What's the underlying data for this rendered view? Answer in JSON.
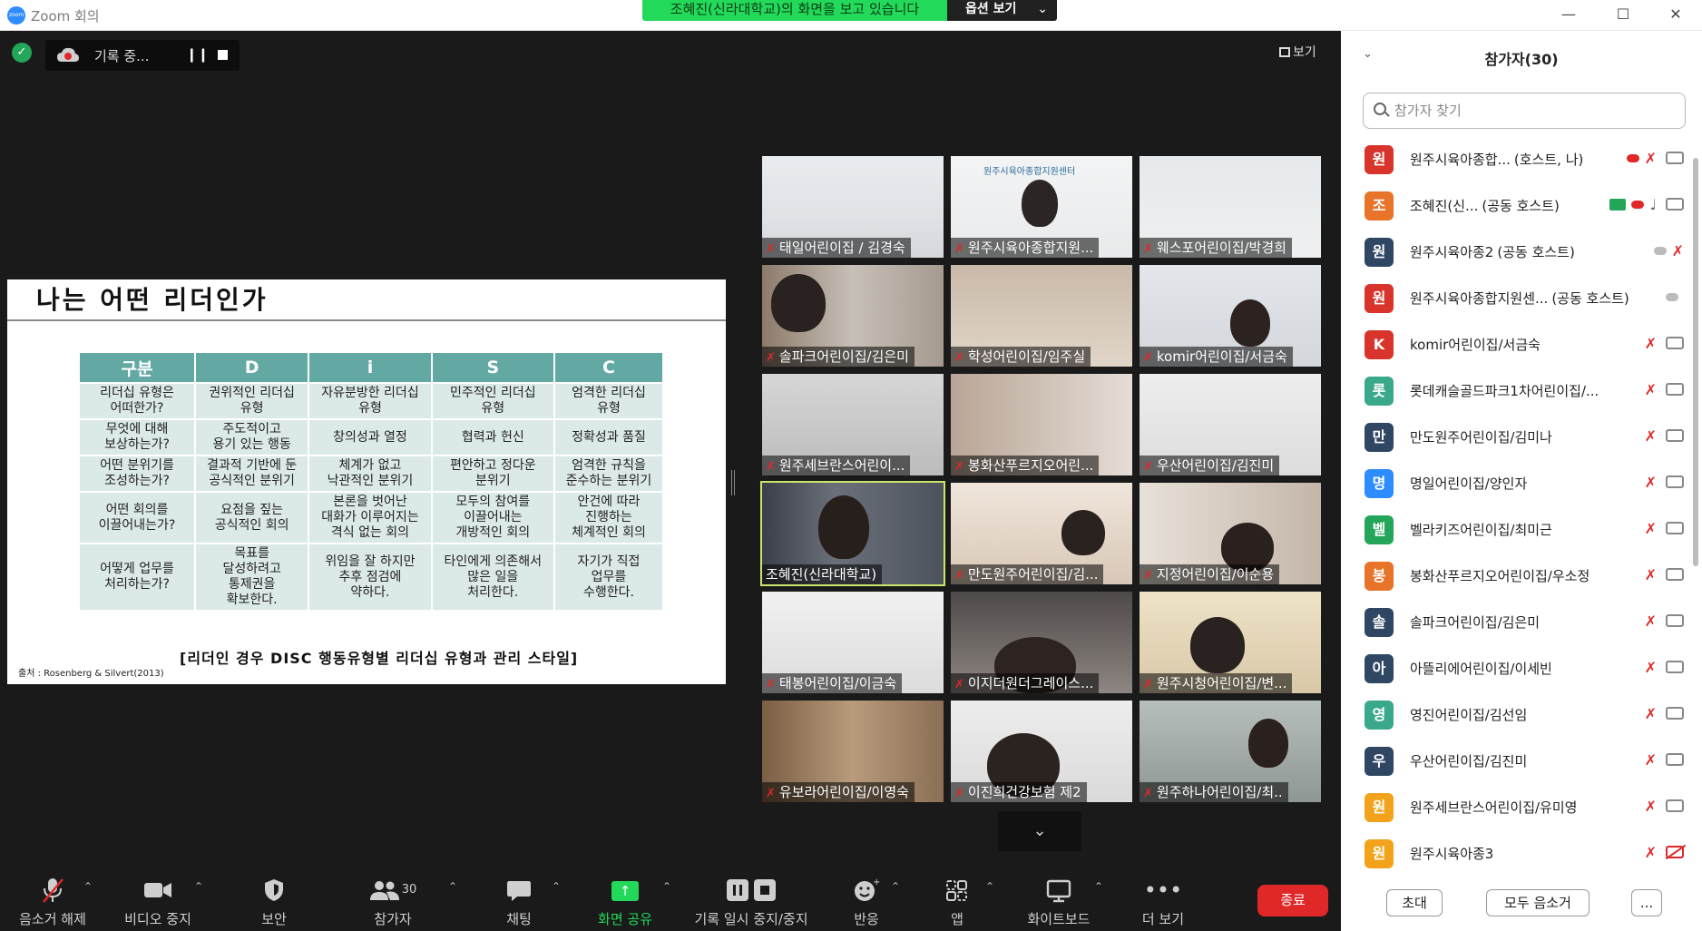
{
  "window": {
    "title": "Zoom 회의",
    "logo_text": "zoom"
  },
  "share_banner": {
    "text": "조혜진(신라대학교)의 화면을 보고 있습니다",
    "options": "옵션 보기"
  },
  "recording": {
    "label": "기록 중..."
  },
  "view_button": {
    "label": "보기"
  },
  "slide": {
    "title": "나는 어떤 리더인가",
    "headers": [
      "구분",
      "D",
      "i",
      "S",
      "C"
    ],
    "rows": [
      [
        "리더십 유형은\n어떠한가?",
        "권위적인 리더십\n유형",
        "자유분방한 리더십\n유형",
        "민주적인 리더십\n유형",
        "엄격한 리더십\n유형"
      ],
      [
        "무엇에 대해\n보상하는가?",
        "주도적이고\n용기 있는 행동",
        "창의성과 열정",
        "협력과 헌신",
        "정확성과 품질"
      ],
      [
        "어떤 분위기를\n조성하는가?",
        "결과적 기반에 둔\n공식적인 분위기",
        "체계가 없고\n낙관적인 분위기",
        "편안하고 정다운\n분위기",
        "엄격한 규칙을\n준수하는 분위기"
      ],
      [
        "어떤 회의를\n이끌어내는가?",
        "요점을 짚는\n공식적인 회의",
        "본론을 벗어난\n대화가 이루어지는\n격식 없는 회의",
        "모두의 참여를\n이끌어내는\n개방적인 회의",
        "안건에 따라\n진행하는\n체계적인 회의"
      ],
      [
        "어떻게 업무를\n처리하는가?",
        "목표를\n달성하려고\n통제권을\n확보한다.",
        "위임을 잘 하지만\n추후 점검에\n약하다.",
        "타인에게 의존해서\n많은 일을\n처리한다.",
        "자기가 직접\n업무를\n수행한다."
      ]
    ],
    "caption": "[리더인 경우 DISC 행동유형별 리더십 유형과 관리 스타일]",
    "source": "출처 : Rosenberg & Silvert(2013)"
  },
  "video_tiles": [
    {
      "label": "태일어린이집 / 김경숙",
      "muted": true
    },
    {
      "label": "원주시육아종합지원...",
      "muted": true
    },
    {
      "label": "웨스포어린이집/박경희",
      "muted": true
    },
    {
      "label": "솔파크어린이집/김은미",
      "muted": true
    },
    {
      "label": "학성어린이집/임주실",
      "muted": true
    },
    {
      "label": "komir어린이집/서금숙",
      "muted": true
    },
    {
      "label": "원주세브란스어린이...",
      "muted": true
    },
    {
      "label": "봉화산푸르지오어린...",
      "muted": true
    },
    {
      "label": "우산어린이집/김진미",
      "muted": true
    },
    {
      "label": "조혜진(신라대학교)",
      "muted": false
    },
    {
      "label": "만도원주어린이집/김...",
      "muted": true
    },
    {
      "label": "지정어린이집/이순용",
      "muted": true
    },
    {
      "label": "태봉어린이집/이금숙",
      "muted": true
    },
    {
      "label": "이지더원더그레이스...",
      "muted": true
    },
    {
      "label": "원주시청어린이집/변...",
      "muted": true
    },
    {
      "label": "유보라어린이집/이영숙",
      "muted": true
    },
    {
      "label": "이진희건강보험 제2",
      "muted": true
    },
    {
      "label": "원주하나어린이집/최..",
      "muted": true
    }
  ],
  "video_logo_text": "원주시육아종합지원센터",
  "toolbar": {
    "unmute": "음소거 해제",
    "stop_video": "비디오 중지",
    "security": "보안",
    "participants": "참가자",
    "participants_count": "30",
    "chat": "채팅",
    "share_screen": "화면 공유",
    "rec_pause": "기록 일시 중지/중지",
    "reactions": "반응",
    "apps": "앱",
    "whiteboard": "화이트보드",
    "more": "더 보기",
    "end": "종료"
  },
  "panel": {
    "title": "참가자(30)",
    "search_placeholder": "참가자 찾기",
    "participants": [
      {
        "initial": "원",
        "color": "#d9342b",
        "name": "원주시육아종합...",
        "role": "(호스트, 나)",
        "rec": true,
        "mic": "muted",
        "cam": "on"
      },
      {
        "initial": "조",
        "color": "#e8742a",
        "name": "조혜진(신...",
        "role": "(공동 호스트)",
        "share": true,
        "rec": true,
        "mic": "on",
        "cam": "on"
      },
      {
        "initial": "원",
        "color": "#2f4763",
        "name": "원주시육아종2",
        "role": "(공동 호스트)",
        "rec_gray": true,
        "mic": "muted",
        "cam": "none"
      },
      {
        "initial": "원",
        "color": "#d9342b",
        "name": "원주시육아종합지원센...",
        "role": "(공동 호스트)",
        "rec_gray": true,
        "mic": "none",
        "cam": "none"
      },
      {
        "initial": "K",
        "color": "#d9342b",
        "name": "komir어린이집/서금숙",
        "role": "",
        "mic": "muted",
        "cam": "on"
      },
      {
        "initial": "롯",
        "color": "#3aa88a",
        "name": "롯데캐슬골드파크1차어린이집/...",
        "role": "",
        "mic": "muted",
        "cam": "on"
      },
      {
        "initial": "만",
        "color": "#2f4763",
        "name": "만도원주어린이집/김미나",
        "role": "",
        "mic": "muted",
        "cam": "on"
      },
      {
        "initial": "명",
        "color": "#2d8cff",
        "name": "명일어린이집/양인자",
        "role": "",
        "mic": "muted",
        "cam": "on"
      },
      {
        "initial": "벨",
        "color": "#23a55a",
        "name": "벨라키즈어린이집/최미근",
        "role": "",
        "mic": "muted",
        "cam": "on"
      },
      {
        "initial": "봉",
        "color": "#e8742a",
        "name": "봉화산푸르지오어린이집/우소정",
        "role": "",
        "mic": "muted",
        "cam": "on"
      },
      {
        "initial": "솔",
        "color": "#2f4763",
        "name": "솔파크어린이집/김은미",
        "role": "",
        "mic": "muted",
        "cam": "on"
      },
      {
        "initial": "아",
        "color": "#2f4763",
        "name": "아뜰리에어린이집/이세빈",
        "role": "",
        "mic": "muted",
        "cam": "on"
      },
      {
        "initial": "영",
        "color": "#3aa88a",
        "name": "영진어린이집/김선임",
        "role": "",
        "mic": "muted",
        "cam": "on"
      },
      {
        "initial": "우",
        "color": "#2f4763",
        "name": "우산어린이집/김진미",
        "role": "",
        "mic": "muted",
        "cam": "on"
      },
      {
        "initial": "원",
        "color": "#f2a31b",
        "name": "원주세브란스어린이집/유미영",
        "role": "",
        "mic": "muted",
        "cam": "on"
      },
      {
        "initial": "원",
        "color": "#f2a31b",
        "name": "원주시육아종3",
        "role": "",
        "mic": "muted",
        "cam": "off"
      }
    ],
    "invite": "초대",
    "mute_all": "모두 음소거",
    "more": "..."
  }
}
